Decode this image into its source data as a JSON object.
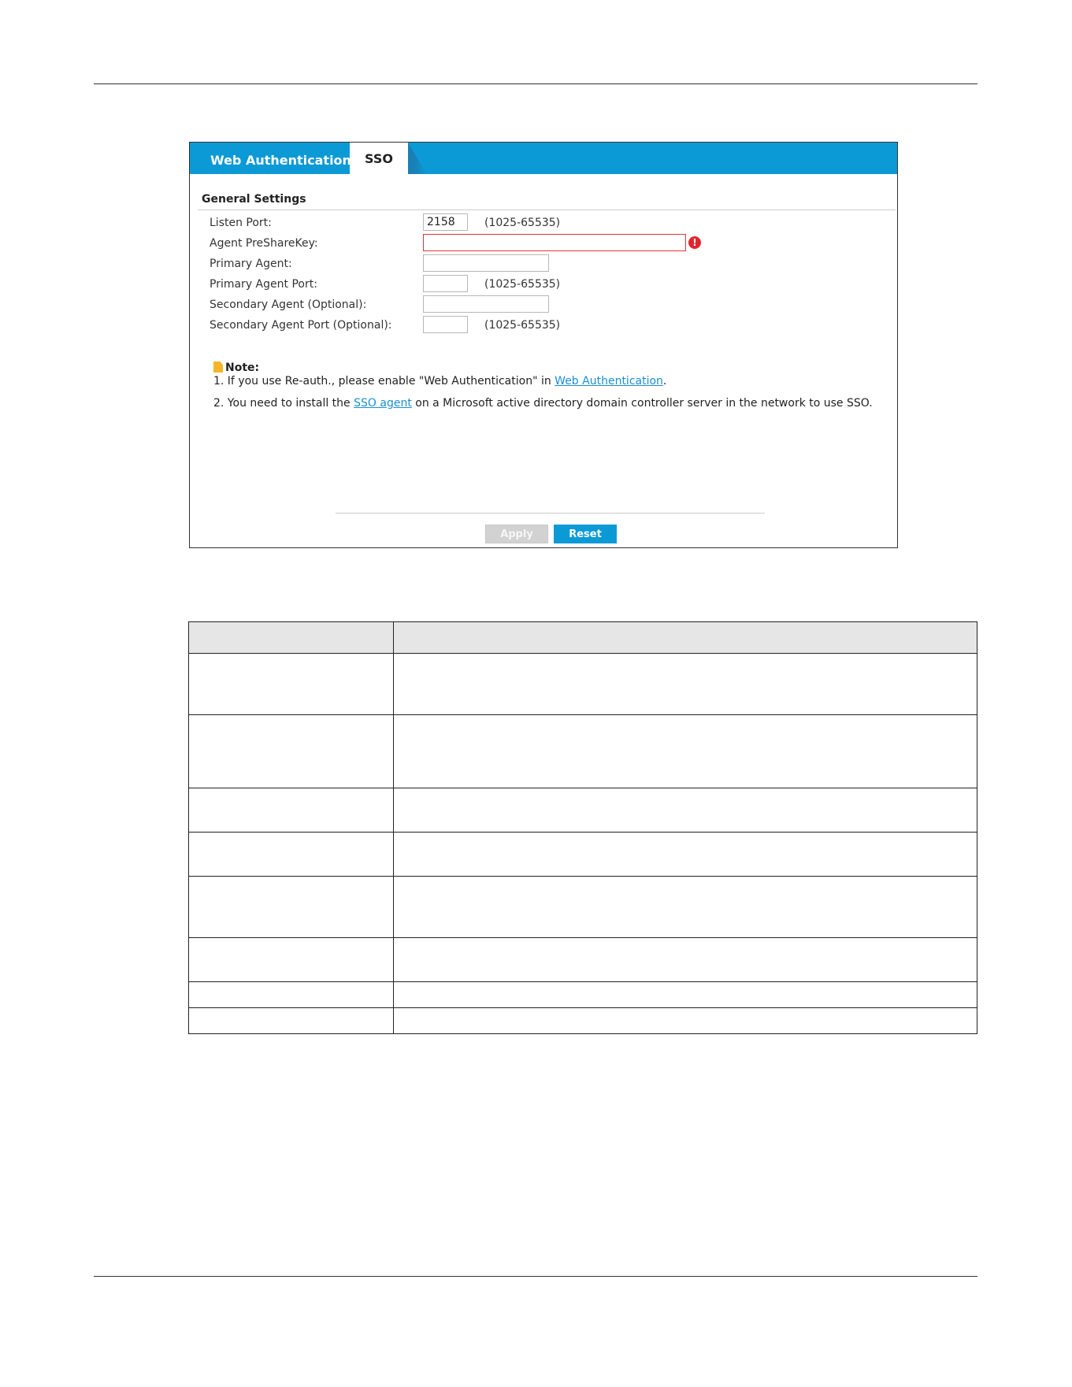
{
  "tabs": [
    {
      "label": "Web Authentication",
      "active": false
    },
    {
      "label": "SSO",
      "active": true
    }
  ],
  "section_title": "General Settings",
  "form": {
    "listen_port": {
      "label": "Listen Port:",
      "value": "2158",
      "range": "(1025-65535)"
    },
    "agent_presharekey": {
      "label": "Agent PreShareKey:",
      "value": "",
      "error": true
    },
    "primary_agent": {
      "label": "Primary Agent:",
      "value": ""
    },
    "primary_agent_port": {
      "label": "Primary Agent Port:",
      "value": "",
      "range": "(1025-65535)"
    },
    "secondary_agent": {
      "label": "Secondary Agent (Optional):",
      "value": ""
    },
    "secondary_agent_port": {
      "label": "Secondary Agent Port (Optional):",
      "value": "",
      "range": "(1025-65535)"
    }
  },
  "note": {
    "heading": "Note:",
    "line1_prefix": "1. If you use Re-auth., please enable \"Web Authentication\" in ",
    "line1_link": "Web Authentication",
    "line1_suffix": ".",
    "line2_prefix": "2. You need to install the ",
    "line2_link": "SSO agent",
    "line2_suffix": " on a Microsoft active directory domain controller server in the network to use SSO."
  },
  "buttons": {
    "apply": "Apply",
    "reset": "Reset"
  },
  "colors": {
    "accent": "#0b9ad6",
    "error": "#e0262f",
    "link": "#1a8fd0"
  },
  "table": {
    "rows": [
      {
        "label": "",
        "desc": ""
      },
      {
        "label": "",
        "desc": ""
      },
      {
        "label": "",
        "desc": ""
      },
      {
        "label": "",
        "desc": ""
      },
      {
        "label": "",
        "desc": ""
      },
      {
        "label": "",
        "desc": ""
      },
      {
        "label": "",
        "desc": ""
      },
      {
        "label": "",
        "desc": ""
      }
    ]
  }
}
